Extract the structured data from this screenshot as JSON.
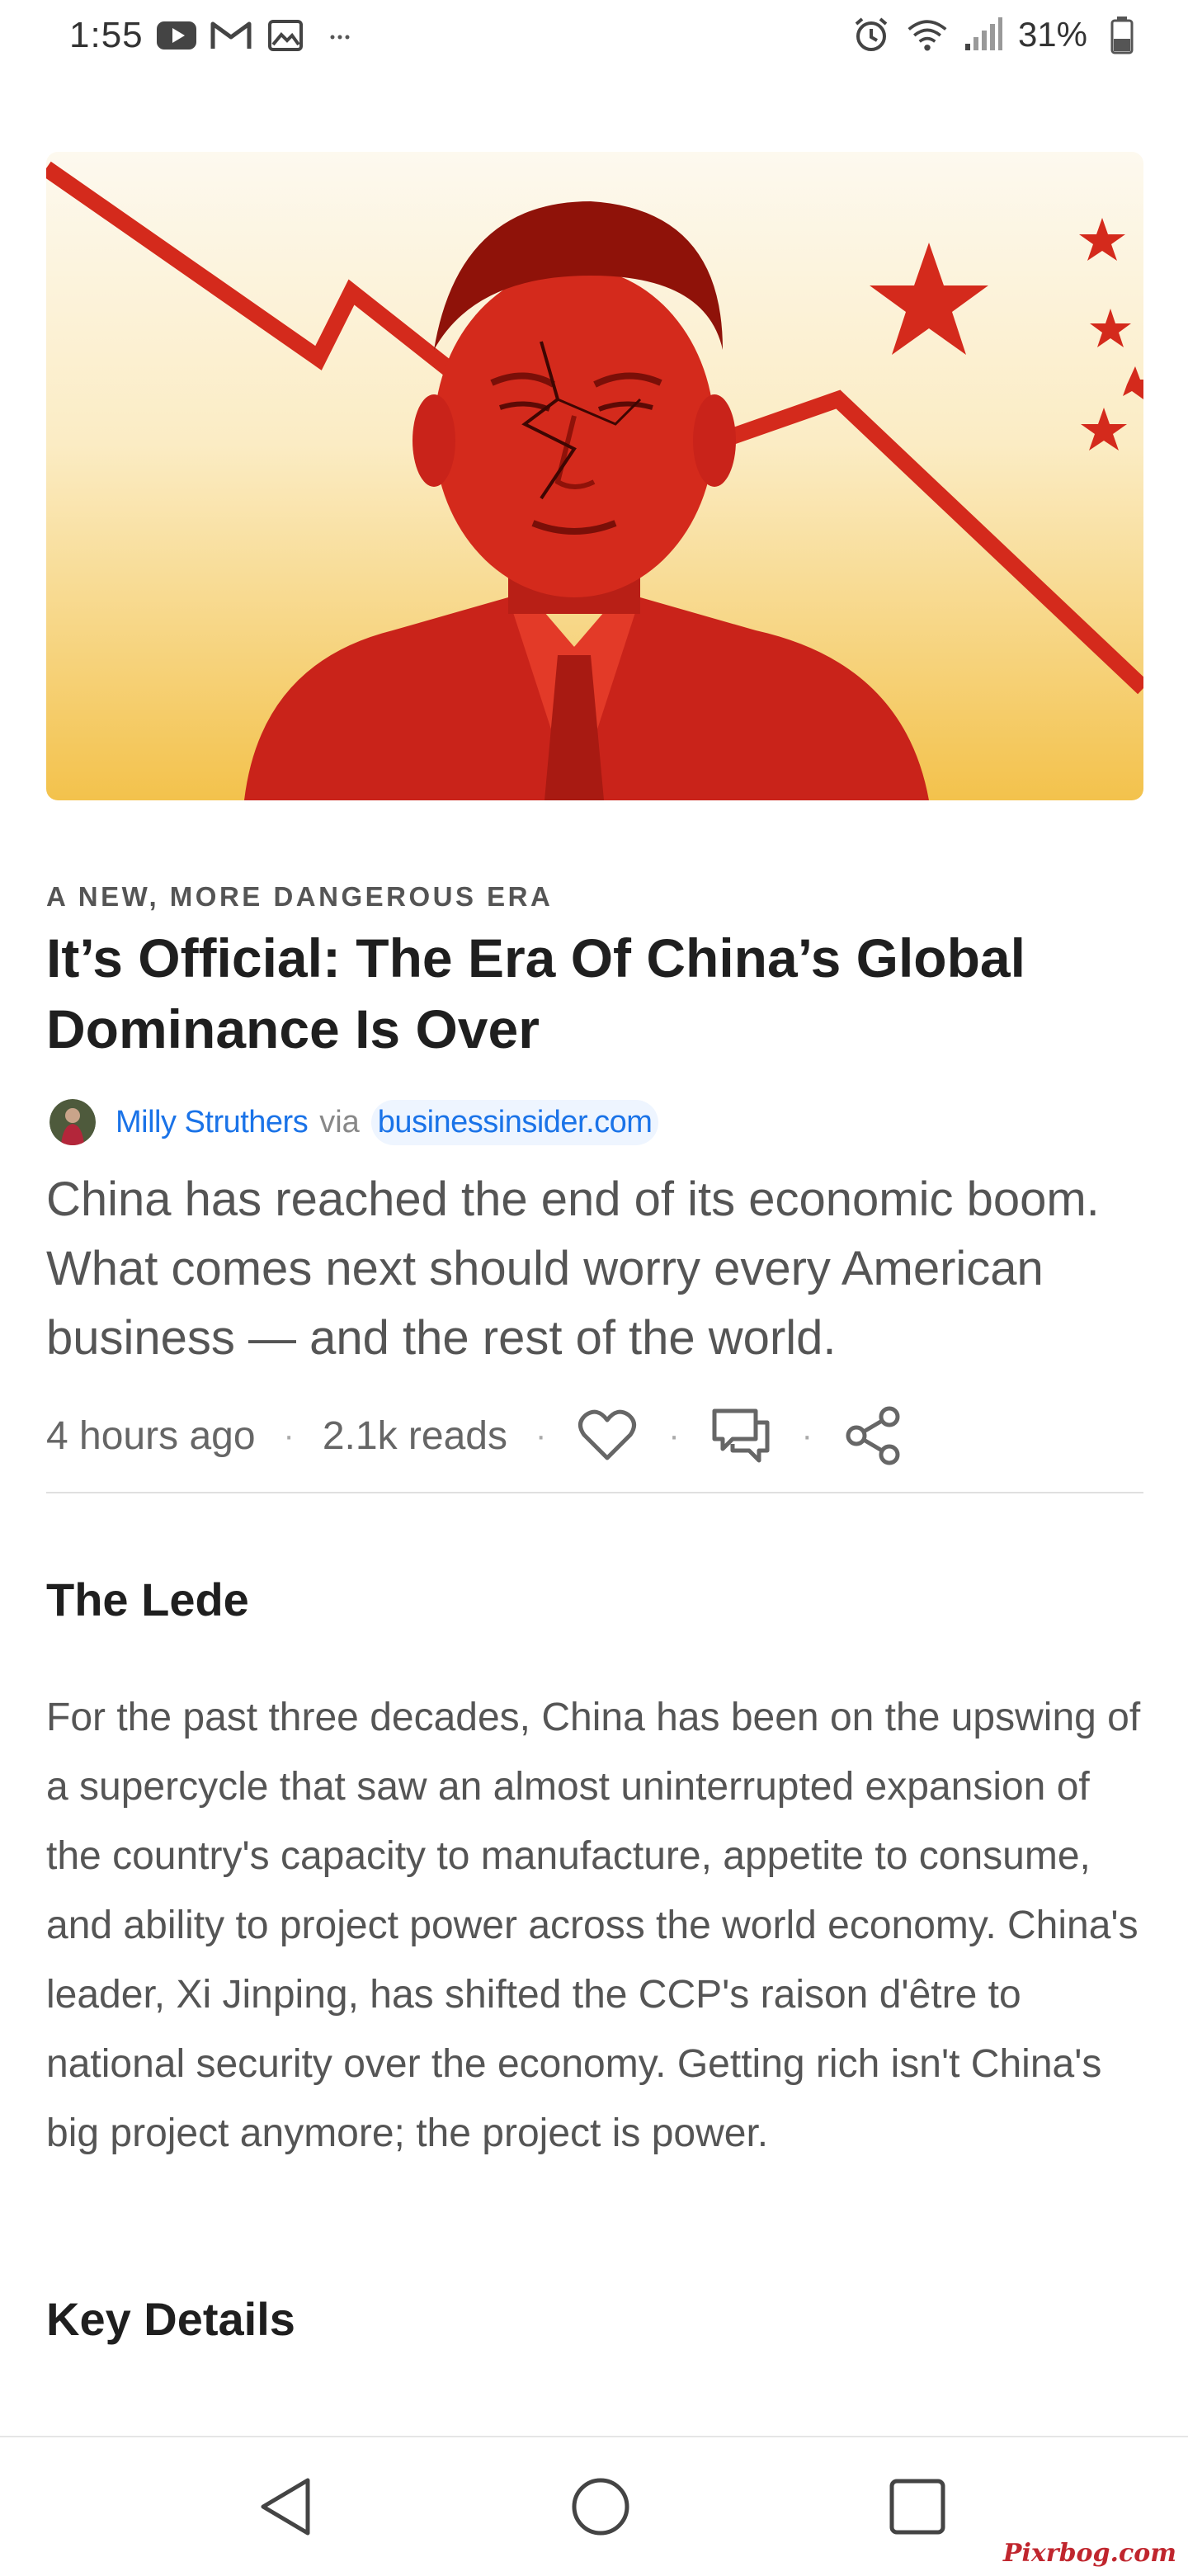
{
  "status_bar": {
    "time": "1:55",
    "battery_percent": "31%",
    "notification_icons": [
      "youtube-icon",
      "gmail-icon",
      "gallery-icon",
      "more-dots-icon"
    ],
    "system_icons": [
      "alarm-icon",
      "wifi-icon",
      "signal-icon",
      "battery-icon"
    ]
  },
  "article": {
    "kicker": "A NEW, MORE DANGEROUS ERA",
    "title": "It’s Official: The Era Of China’s Global Dominance Is Over",
    "author": "Milly Struthers",
    "via": "via",
    "source": "businessinsider.com",
    "deck": "China has reached the end of its economic boom. What comes next should worry every American business — and the rest of the world.",
    "time_ago": "4 hours ago",
    "reads": "2.1k reads",
    "actions": [
      "heart-icon",
      "comment-icon",
      "share-icon"
    ]
  },
  "sections": {
    "lede_heading": "The Lede",
    "lede_body": "For the past three decades, China has been on the upswing of a supercycle that saw an almost uninterrupted expansion of the country's capacity to manufacture, appetite to consume, and ability to project power across the world economy. China's leader, Xi Jinping, has shifted the CCP's raison d'être to national security over the economy. Getting rich isn't China's big project anymore; the project is power.",
    "key_details_heading": "Key Details"
  },
  "nav_bar": {
    "buttons": [
      "back-icon",
      "home-icon",
      "recents-icon"
    ]
  },
  "watermark": "Pixrbog.com",
  "colors": {
    "link": "#1a73e8",
    "hero_red": "#d42a1c",
    "hero_yellow": "#f3c24c"
  }
}
